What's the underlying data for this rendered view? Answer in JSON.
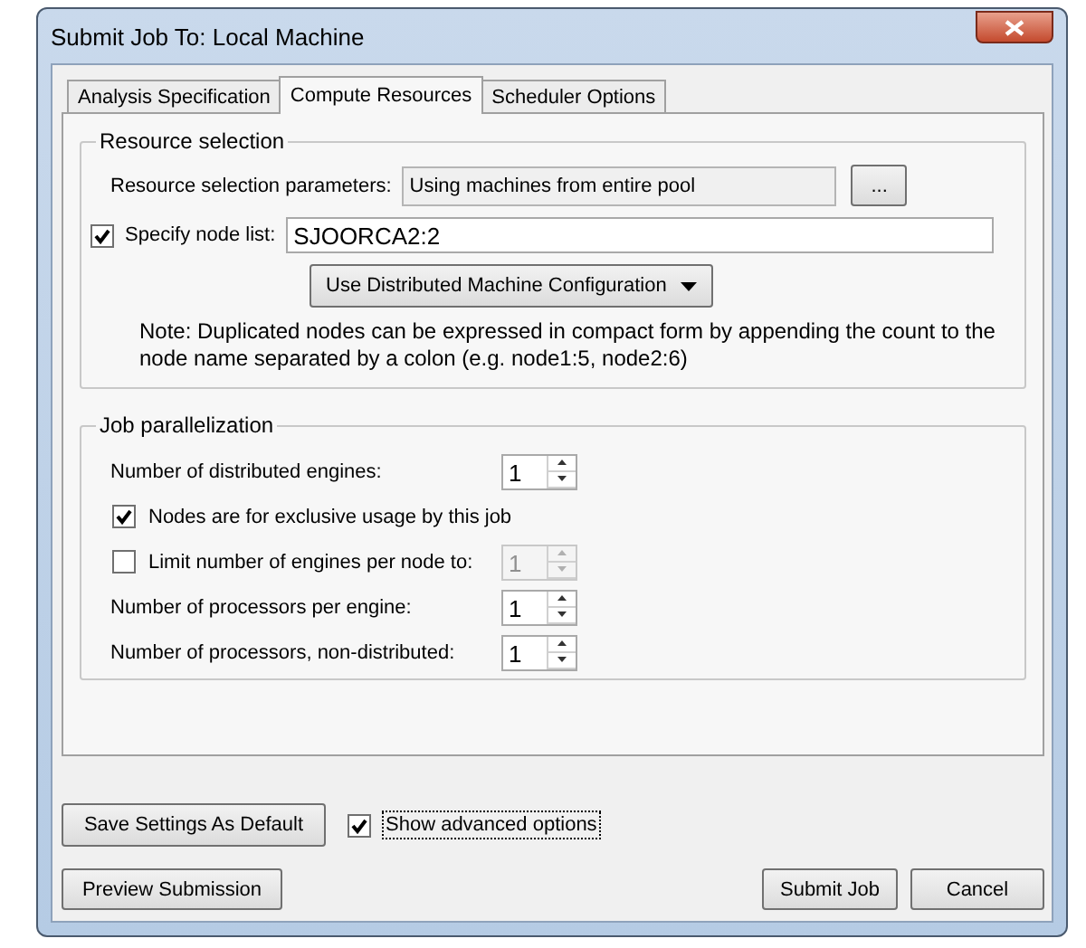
{
  "window": {
    "title": "Submit Job To: Local Machine"
  },
  "tabs": [
    {
      "label": "Analysis Specification",
      "selected": false
    },
    {
      "label": "Compute Resources",
      "selected": true
    },
    {
      "label": "Scheduler Options",
      "selected": false
    }
  ],
  "resource_selection": {
    "legend": "Resource selection",
    "parameters_label": "Resource selection parameters:",
    "parameters_value": "Using machines from entire pool",
    "browse_button": "...",
    "node_list": {
      "label": "Specify node list:",
      "checked": true,
      "value": "SJOORCA2:2"
    },
    "config_button": "Use Distributed Machine Configuration",
    "note": "Note: Duplicated nodes can be expressed in compact form by appending the count to the node name separated by a colon (e.g. node1:5, node2:6)"
  },
  "job_parallelization": {
    "legend": "Job parallelization",
    "rows": [
      {
        "kind": "spinner",
        "label": "Number of distributed engines:",
        "value": "1",
        "disabled": false
      },
      {
        "kind": "checkbox",
        "label": "Nodes are for exclusive usage by this job",
        "checked": true
      },
      {
        "kind": "checkbox_spinner",
        "label": "Limit number of engines per node to:",
        "checked": false,
        "value": "1",
        "disabled": true
      },
      {
        "kind": "spinner",
        "label": "Number of processors per engine:",
        "value": "1",
        "disabled": false
      },
      {
        "kind": "spinner",
        "label": "Number of processors, non-distributed:",
        "value": "1",
        "disabled": false
      }
    ]
  },
  "save_default_button": "Save Settings As Default",
  "show_advanced": {
    "label": "Show advanced options",
    "checked": true
  },
  "preview_button": "Preview Submission",
  "submit_button": "Submit Job",
  "cancel_button": "Cancel"
}
